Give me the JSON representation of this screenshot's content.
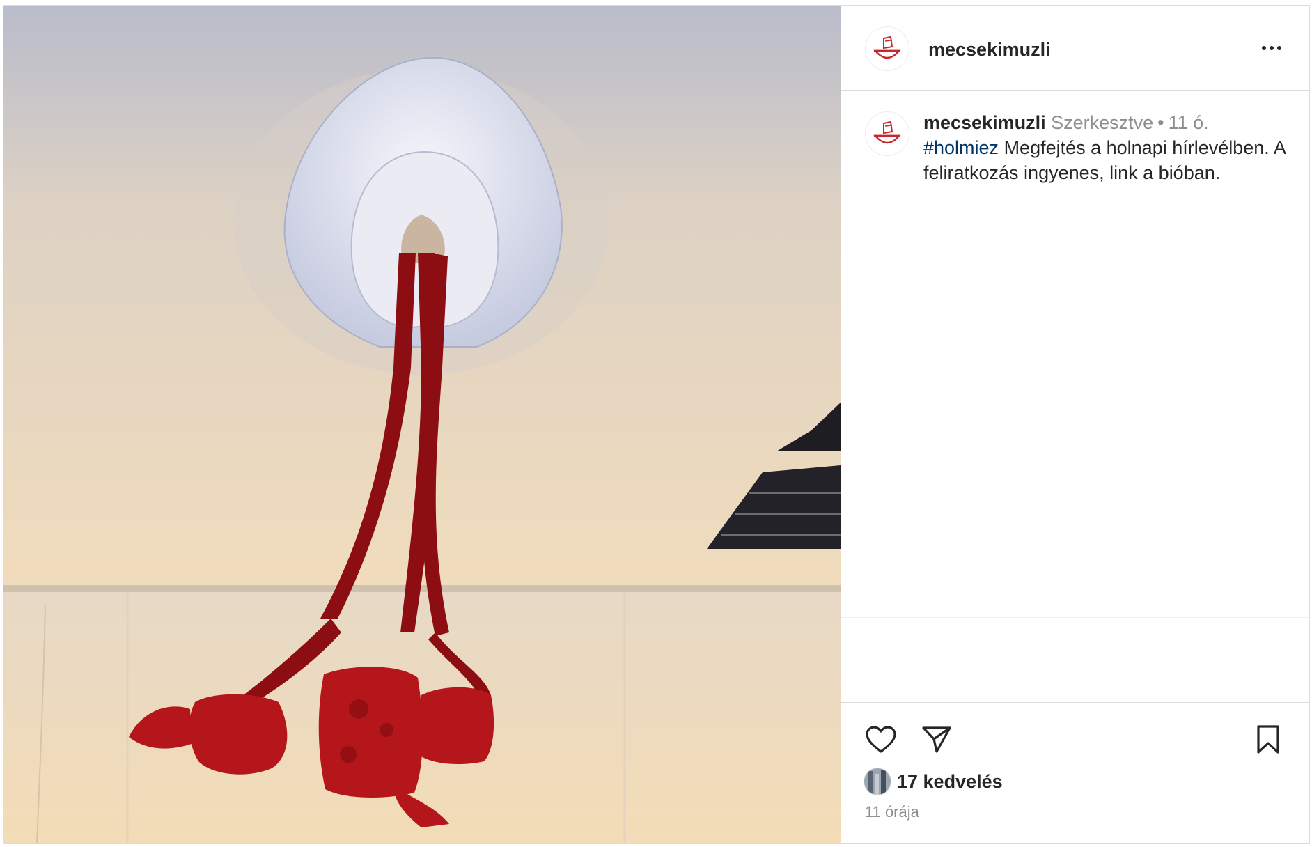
{
  "post": {
    "username": "mecsekimuzli",
    "caption": {
      "username": "mecsekimuzli",
      "edited_label": "Szerkesztve",
      "separator": "•",
      "time_short": "11 ó.",
      "hashtag": "#holmiez",
      "text": " Megfejtés a holnapi hírlevélben. A feliratkozás ingyenes, link a bióban."
    },
    "likes_label": "17 kedvelés",
    "timestamp": "11 órája"
  },
  "icons": {
    "avatar": "bowl-fist-logo-icon",
    "more": "more-options-icon",
    "like": "heart-icon",
    "share": "paper-plane-icon",
    "save": "bookmark-icon"
  },
  "colors": {
    "text": "#262626",
    "secondary": "#8e8e8e",
    "hashtag": "#00376b",
    "border": "#dbdbdb",
    "brand_red": "#c9262c"
  }
}
